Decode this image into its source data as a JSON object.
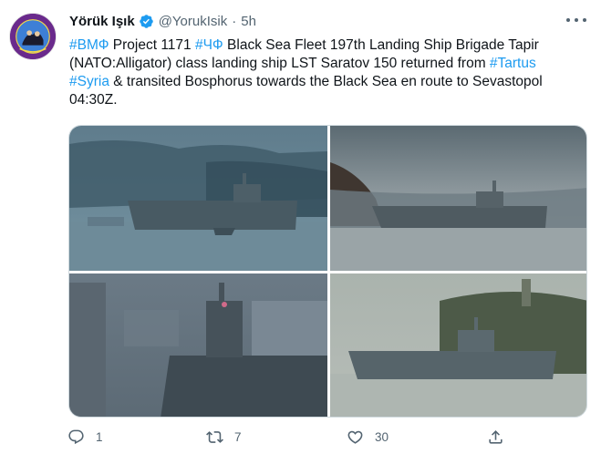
{
  "author": {
    "name": "Yörük Işık",
    "handle": "@YorukIsik",
    "separator": "·",
    "time": "5h",
    "verified": true
  },
  "tweet": {
    "lines": [
      [
        {
          "text": "#ВМФ",
          "hashtag": true
        },
        {
          "text": " Project 1171 ",
          "hashtag": false
        },
        {
          "text": "#ЧФ",
          "hashtag": true
        },
        {
          "text": " Black Sea Fleet 197th Landing Ship Brigade Tapir",
          "hashtag": false
        }
      ],
      [
        {
          "text": "(NATO:Alligator) class landing ship LST Saratov 150 returned from ",
          "hashtag": false
        },
        {
          "text": "#Tartus",
          "hashtag": true
        }
      ],
      [
        {
          "text": "#Syria",
          "hashtag": true
        },
        {
          "text": " & transited Bosphorus towards the Black Sea en route to Sevastopol",
          "hashtag": false
        }
      ],
      [
        {
          "text": "04:30Z.",
          "hashtag": false
        }
      ]
    ]
  },
  "media": {
    "photo_count": 4,
    "photos": [
      {
        "name": "photo-1",
        "description": "landing ship with escort boat, misty blue"
      },
      {
        "name": "photo-2",
        "description": "landing ship passing hills at dusk"
      },
      {
        "name": "photo-3",
        "description": "close-up of ship superstructure near city"
      },
      {
        "name": "photo-4",
        "description": "landing ship in front of wooded hill and tower"
      }
    ]
  },
  "actions": {
    "reply_count": "1",
    "retweet_count": "7",
    "like_count": "30"
  },
  "colors": {
    "accent": "#1d9bf0",
    "text": "#0f1419",
    "muted": "#536471",
    "border": "#cfd9de"
  }
}
